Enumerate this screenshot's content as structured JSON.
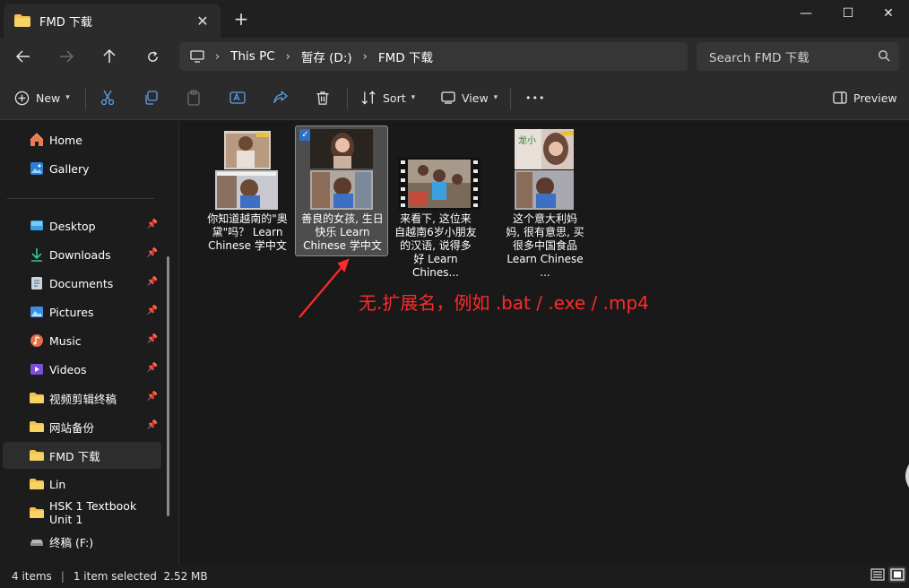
{
  "tab": {
    "title": "FMD 下载",
    "close": "✕",
    "new": "+"
  },
  "window": {
    "minimize": "—",
    "maximize": "☐",
    "close": "✕"
  },
  "breadcrumb": [
    "This PC",
    "暂存 (D:)",
    "FMD 下载"
  ],
  "search": {
    "placeholder": "Search FMD 下载"
  },
  "commands": {
    "new": "New",
    "sort": "Sort",
    "view": "View",
    "more": "•••",
    "preview": "Preview"
  },
  "sidebar": {
    "items": [
      {
        "label": "Home",
        "icon": "home-icon",
        "pinned": false
      },
      {
        "label": "Gallery",
        "icon": "gallery-icon",
        "pinned": false
      },
      {
        "label": "Desktop",
        "icon": "desktop-icon",
        "pinned": true
      },
      {
        "label": "Downloads",
        "icon": "download-icon",
        "pinned": true
      },
      {
        "label": "Documents",
        "icon": "document-icon",
        "pinned": true
      },
      {
        "label": "Pictures",
        "icon": "picture-icon",
        "pinned": true
      },
      {
        "label": "Music",
        "icon": "music-icon",
        "pinned": true
      },
      {
        "label": "Videos",
        "icon": "video-icon",
        "pinned": true
      },
      {
        "label": "视频剪辑终稿",
        "icon": "folder-icon",
        "pinned": true
      },
      {
        "label": "网站备份",
        "icon": "folder-icon",
        "pinned": true
      },
      {
        "label": "FMD 下载",
        "icon": "folder-icon",
        "pinned": false,
        "selected": true
      },
      {
        "label": "Lin",
        "icon": "folder-icon",
        "pinned": false
      },
      {
        "label": "HSK 1 Textbook Unit 1",
        "icon": "folder-icon",
        "pinned": false
      },
      {
        "label": "终稿 (F:)",
        "icon": "drive-icon",
        "pinned": false
      }
    ]
  },
  "files": [
    {
      "name_lines": [
        "你知道越南的\"奥",
        "黛\"吗？ Learn",
        "Chinese 学中文"
      ],
      "selected": false
    },
    {
      "name_lines": [
        "善良的女孩, 生日",
        "快乐 Learn",
        "Chinese 学中文"
      ],
      "selected": true
    },
    {
      "name_lines": [
        "来看下, 这位来",
        "自越南6岁小朋友",
        "的汉语, 说得多",
        "好 Learn Chines..."
      ],
      "selected": false
    },
    {
      "name_lines": [
        "这个意大利妈",
        "妈, 很有意思, 买",
        "很多中国食品",
        "Learn Chinese ..."
      ],
      "selected": false
    }
  ],
  "annotation": "无.扩展名，例如 .bat / .exe / .mp4",
  "status": {
    "items": "4 items",
    "selection": "1 item selected  2.52 MB"
  },
  "colors": {
    "accent": "#2f6fc6",
    "annotation": "#ff2a2a",
    "folder": "#f2c14e"
  }
}
